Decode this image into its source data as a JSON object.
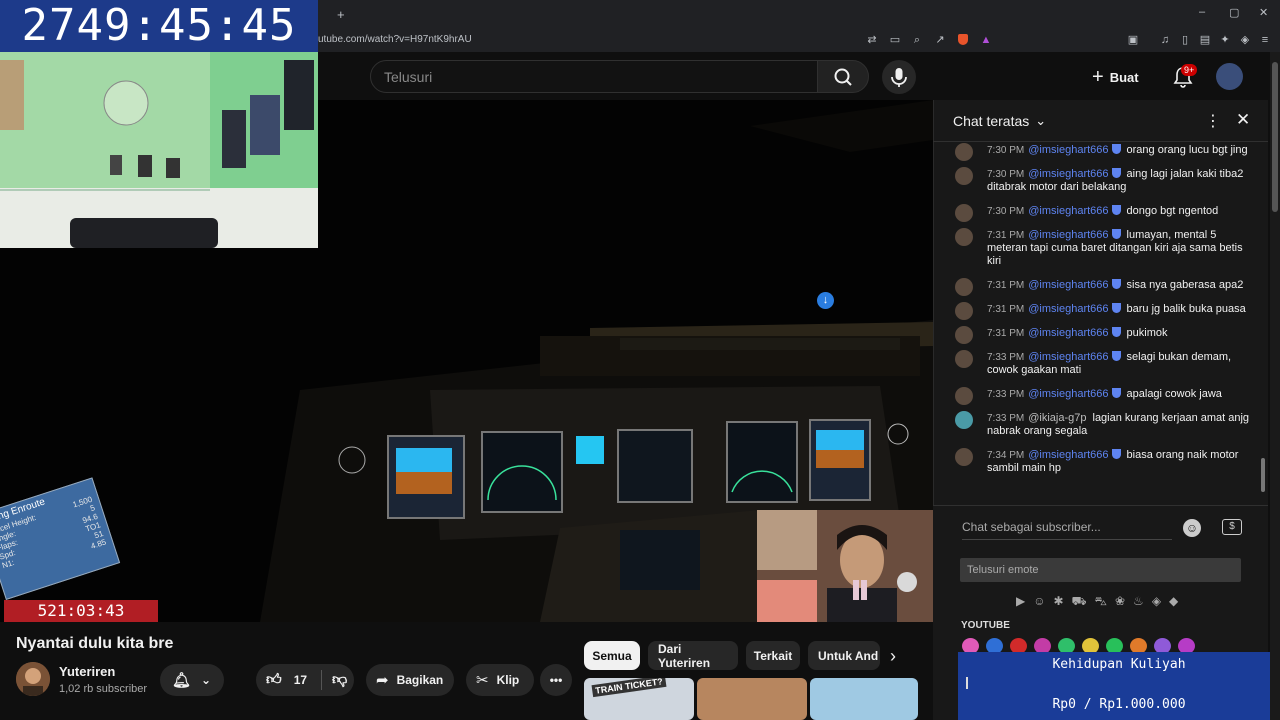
{
  "browser": {
    "url": "utube.com/watch?v=H97ntK9hrAU",
    "new_tab": "+",
    "window_controls": [
      "–",
      "▢",
      "✕"
    ]
  },
  "header": {
    "search_placeholder": "Telusuri",
    "create_label": "Buat",
    "notification_badge": "9+"
  },
  "video": {
    "stream_timer": "2749:45:45",
    "segment_timer": "521:03:43",
    "info_card": {
      "title": "nding Enroute",
      "rows": [
        {
          "k": "Accel Height:",
          "v": "1,500"
        },
        {
          "k": "Angle:",
          "v": "5"
        },
        {
          "k": "Flaps:",
          "v": "94.6"
        },
        {
          "k": "Spd:",
          "v": "TO1"
        },
        {
          "k": "N1:",
          "v": "51"
        },
        {
          "k": "",
          "v": "4.85"
        }
      ]
    }
  },
  "below_video": {
    "title": "Nyantai dulu kita bre",
    "channel_name": "Yuteriren",
    "subscribers": "1,02 rb subscriber",
    "like_count": "17",
    "share_label": "Bagikan",
    "clip_label": "Klip",
    "chips": [
      "Semua",
      "Dari Yuteriren",
      "Terkait",
      "Untuk And"
    ],
    "thumb_caption": "TRAIN TICKET?"
  },
  "chat": {
    "title": "Chat teratas",
    "messages": [
      {
        "time": "7:30 PM",
        "author": "@imsieghart666",
        "verified": true,
        "text": "orang orang lucu bgt jing"
      },
      {
        "time": "7:30 PM",
        "author": "@imsieghart666",
        "verified": true,
        "text": "aing lagi jalan kaki tiba2 ditabrak motor dari belakang"
      },
      {
        "time": "7:30 PM",
        "author": "@imsieghart666",
        "verified": true,
        "text": "dongo bgt ngentod"
      },
      {
        "time": "7:31 PM",
        "author": "@imsieghart666",
        "verified": true,
        "text": "lumayan, mental 5 meteran tapi cuma baret ditangan kiri aja sama betis kiri"
      },
      {
        "time": "7:31 PM",
        "author": "@imsieghart666",
        "verified": true,
        "text": "sisa nya gaberasa apa2"
      },
      {
        "time": "7:31 PM",
        "author": "@imsieghart666",
        "verified": true,
        "text": "baru jg balik buka puasa"
      },
      {
        "time": "7:31 PM",
        "author": "@imsieghart666",
        "verified": true,
        "text": "pukimok"
      },
      {
        "time": "7:33 PM",
        "author": "@imsieghart666",
        "verified": true,
        "text": "selagi bukan demam, cowok gaakan mati"
      },
      {
        "time": "7:33 PM",
        "author": "@imsieghart666",
        "verified": true,
        "text": "apalagi cowok jawa"
      },
      {
        "time": "7:33 PM",
        "author": "@ikiaja-g7p",
        "verified": false,
        "text": "lagian kurang kerjaan amat anjg nabrak orang segala"
      },
      {
        "time": "7:34 PM",
        "author": "@imsieghart666",
        "verified": true,
        "text": "biasa orang naik motor sambil main hp"
      }
    ],
    "input_placeholder": "Chat sebagai subscriber...",
    "emote_search_placeholder": "Telusuri emote",
    "emote_section": "YOUTUBE"
  },
  "donation": {
    "title": "Kehidupan Kuliyah",
    "amount": "Rp0 / Rp1.000.000",
    "progress": 0
  },
  "colors": {
    "accent_blue": "#5e84f1",
    "timer_bg": "#1d3a8a",
    "timer_red": "#b11e24",
    "donation_bg": "#1a3c98"
  }
}
